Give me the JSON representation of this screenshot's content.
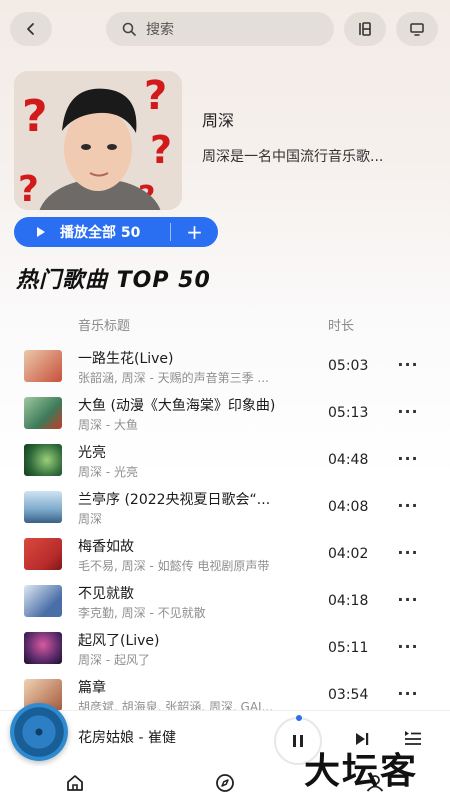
{
  "search": {
    "placeholder": "搜索"
  },
  "topbar": {
    "back_icon": "chevron-left-icon",
    "grid_icon": "grid-view-icon",
    "screen_icon": "monitor-icon"
  },
  "artist": {
    "name": "周深",
    "description": "周深是一名中国流行音乐歌...",
    "play_all_label": "播放全部 50",
    "add_label": "+"
  },
  "section": {
    "title": "热门歌曲 TOP 50",
    "col_title": "音乐标题",
    "col_duration": "时长"
  },
  "songs": [
    {
      "title": "一路生花(Live)",
      "subtitle": "张韶涵, 周深 - 天赐的声音第三季 ...",
      "duration": "05:03",
      "thumb_color": "#c8503c"
    },
    {
      "title": "大鱼 (动漫《大鱼海棠》印象曲)",
      "subtitle": "周深 - 大鱼",
      "duration": "05:13",
      "thumb_color": "#3d7a58"
    },
    {
      "title": "光亮",
      "subtitle": "周深 - 光亮",
      "duration": "04:48",
      "thumb_color": "#2f6a3a"
    },
    {
      "title": "兰亭序 (2022央视夏日歌会“...",
      "subtitle": "周深",
      "duration": "04:08",
      "thumb_color": "#7aa7c9"
    },
    {
      "title": "梅香如故",
      "subtitle": "毛不易, 周深 - 如懿传 电视剧原声带",
      "duration": "04:02",
      "thumb_color": "#b62a2a"
    },
    {
      "title": "不见就散",
      "subtitle": "李克勤, 周深 - 不见就散",
      "duration": "04:18",
      "thumb_color": "#4a6ea8"
    },
    {
      "title": "起风了(Live)",
      "subtitle": "周深 - 起风了",
      "duration": "05:11",
      "thumb_color": "#5a2a6a"
    },
    {
      "title": "篇章",
      "subtitle": "胡彦斌, 胡海泉, 张韶涵, 周深, GAI...",
      "duration": "03:54",
      "thumb_color": "#a65a3c"
    }
  ],
  "player": {
    "now_playing": "花房姑娘 - 崔健",
    "disc_color": "#2c7fc4"
  },
  "nav": {
    "home_icon": "home-icon",
    "discover_icon": "compass-icon"
  },
  "watermark": "大坛客",
  "accent": "#2a6ef2"
}
